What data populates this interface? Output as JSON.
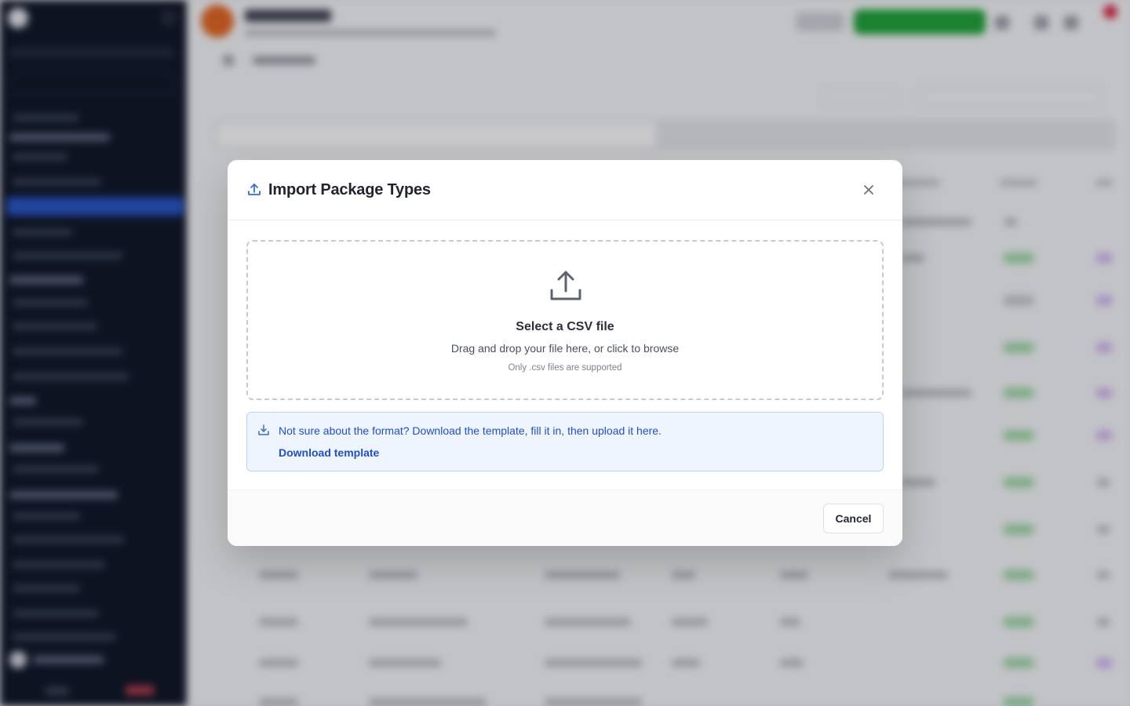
{
  "modal": {
    "title": "Import Package Types",
    "header_icon": "upload-icon",
    "close_icon": "close-icon"
  },
  "dropzone": {
    "icon": "upload-tray-icon",
    "title": "Select a CSV file",
    "subtitle": "Drag and drop your file here, or click to browse",
    "note": "Only .csv files are supported"
  },
  "info": {
    "icon": "download-icon",
    "text": "Not sure about the format? Download the template, fill it in, then upload it here.",
    "link_label": "Download template"
  },
  "footer": {
    "cancel_label": "Cancel"
  },
  "colors": {
    "accent": "#1d4fd0",
    "info_background": "#eff5fe",
    "sidebar": "#0d1424",
    "primary_button": "#1ea238"
  }
}
